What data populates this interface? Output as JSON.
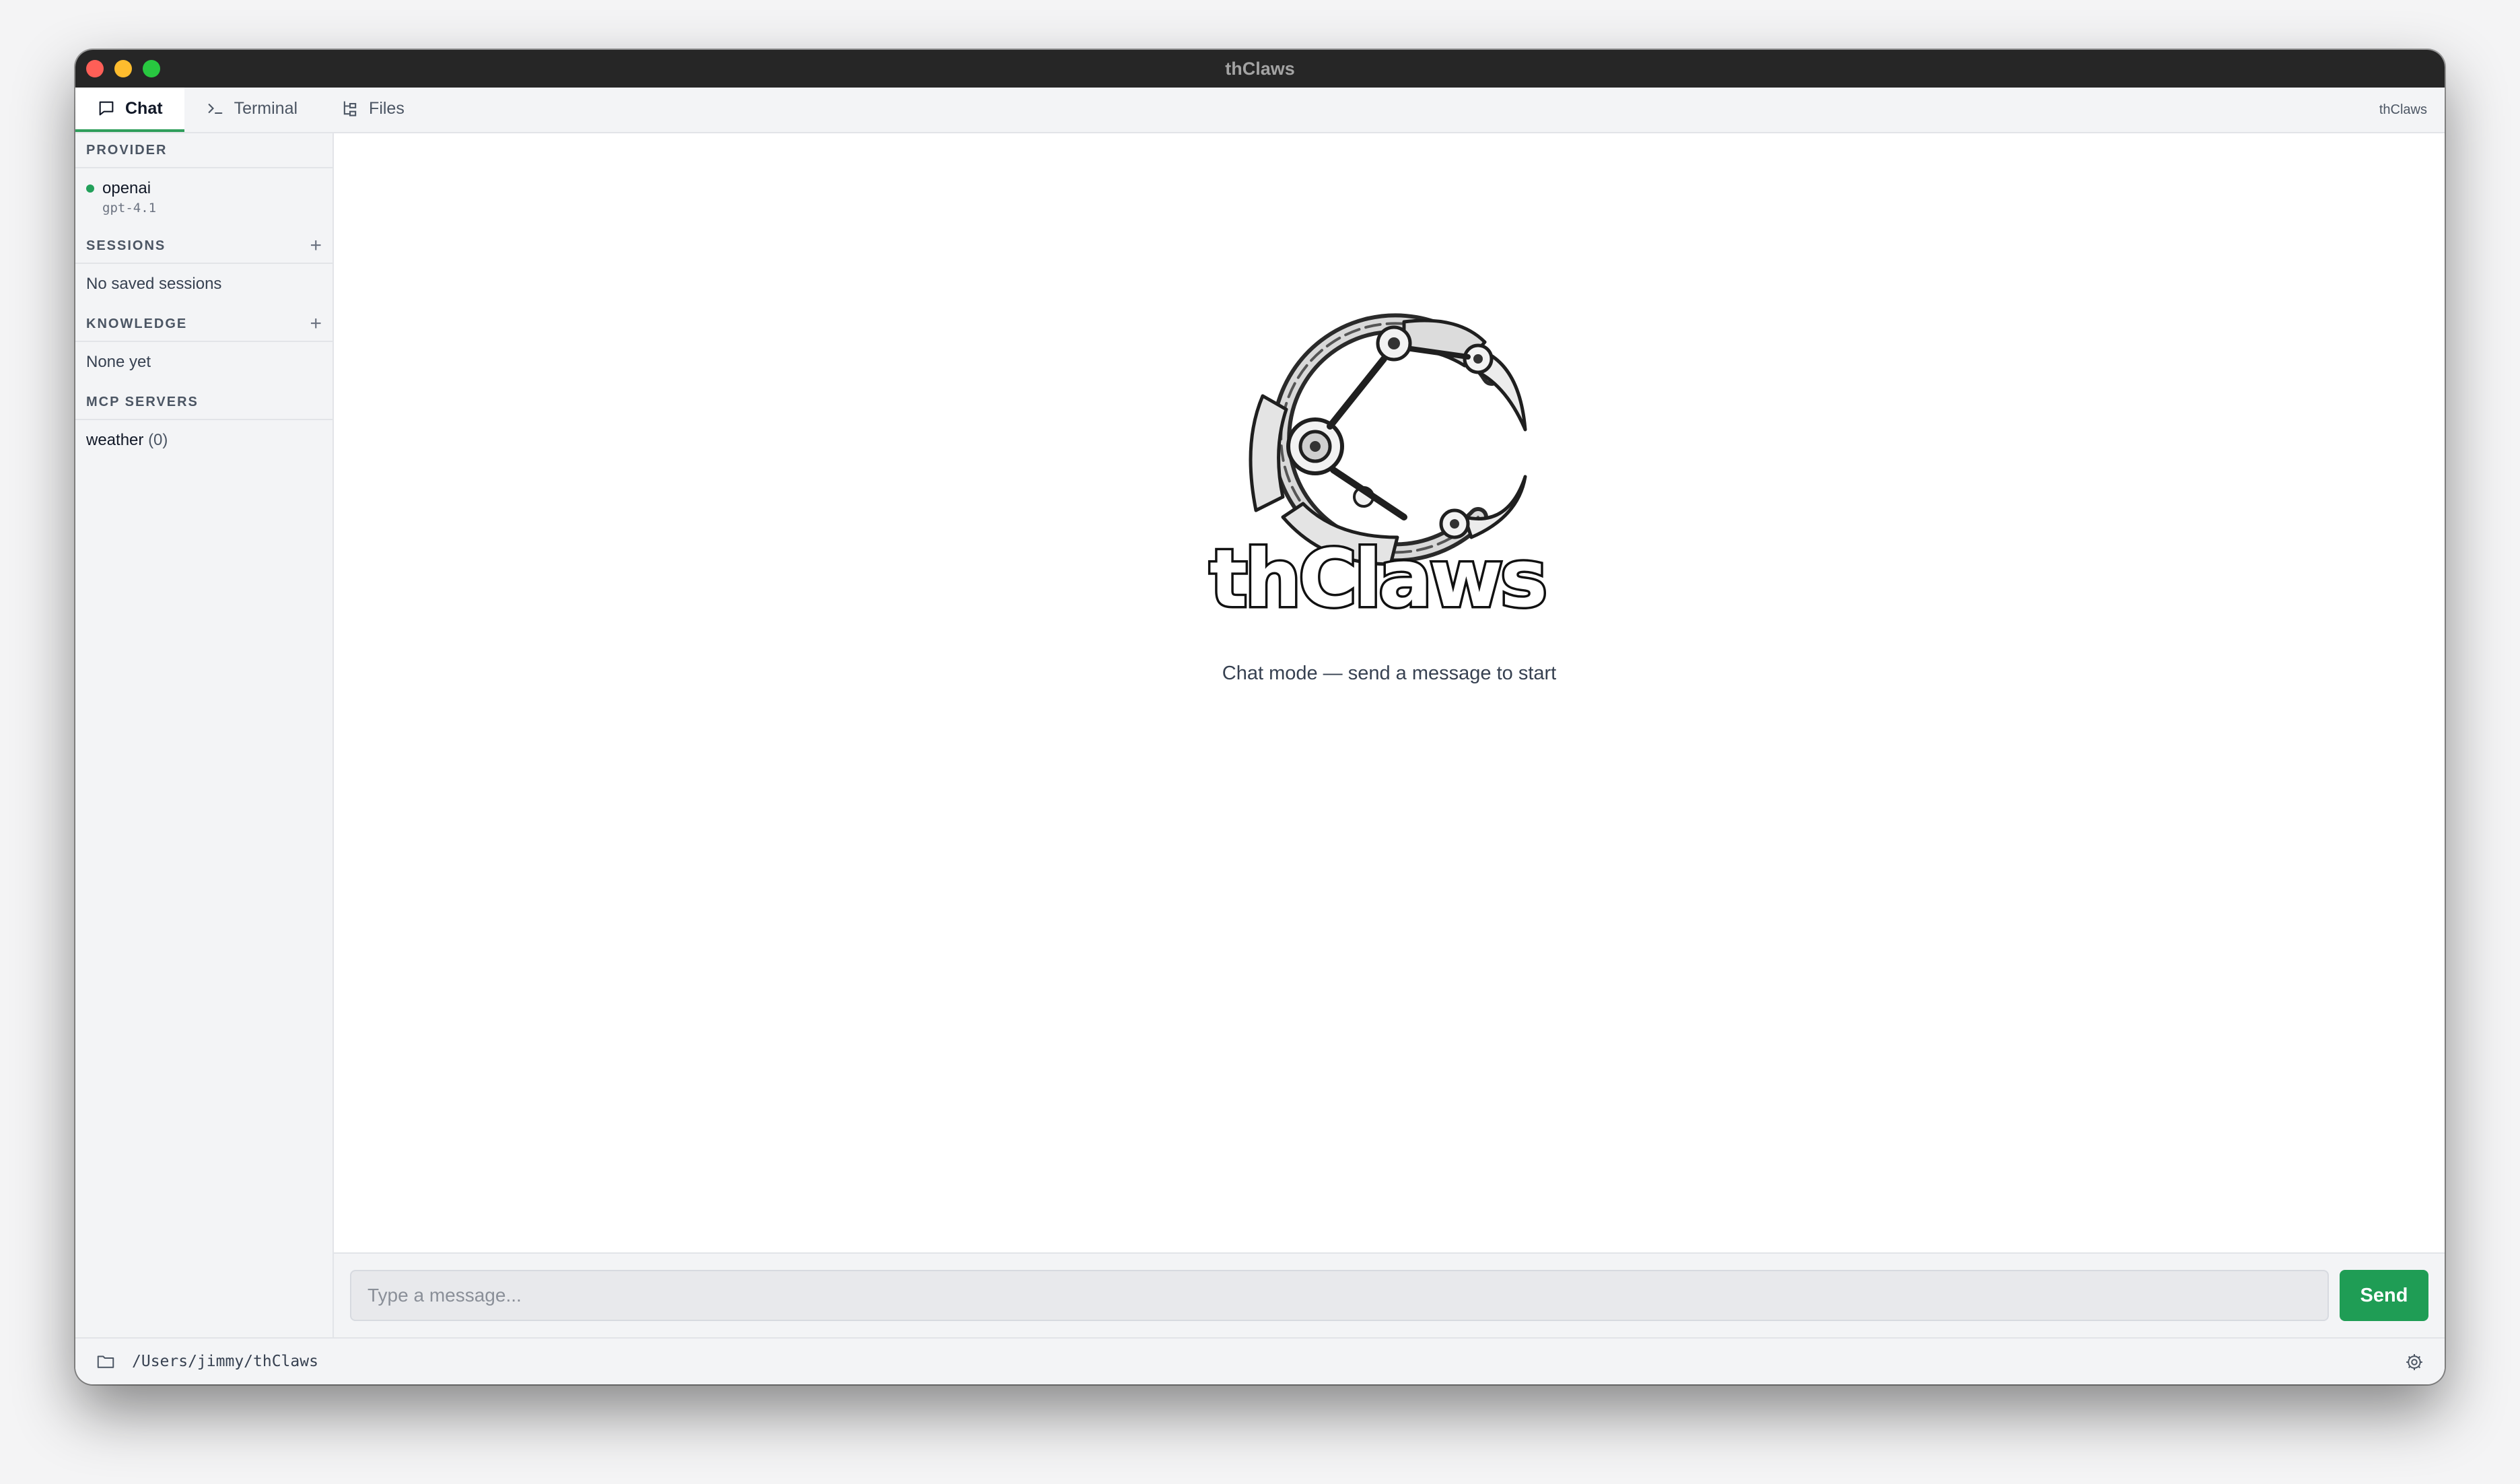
{
  "window": {
    "title": "thClaws"
  },
  "tabs": [
    {
      "label": "Chat",
      "icon": "chat-bubble-icon",
      "active": true
    },
    {
      "label": "Terminal",
      "icon": "terminal-prompt-icon",
      "active": false
    },
    {
      "label": "Files",
      "icon": "file-tree-icon",
      "active": false
    }
  ],
  "tabbar": {
    "app_name": "thClaws"
  },
  "sidebar": {
    "provider": {
      "header": "PROVIDER",
      "name": "openai",
      "model": "gpt-4.1",
      "status_color": "#22a05a"
    },
    "sessions": {
      "header": "SESSIONS",
      "add": "+",
      "empty": "No saved sessions"
    },
    "knowledge": {
      "header": "KNOWLEDGE",
      "add": "+",
      "empty": "None yet"
    },
    "mcp": {
      "header": "MCP SERVERS",
      "items": [
        {
          "name": "weather",
          "count": "(0)"
        }
      ]
    }
  },
  "chat": {
    "logo_text": "thClaws",
    "empty_message": "Chat mode — send a message to start",
    "input_placeholder": "Type a message...",
    "send_label": "Send"
  },
  "status": {
    "path": "/Users/jimmy/thClaws"
  },
  "colors": {
    "accent": "#1f9d55",
    "titlebar": "#262626"
  }
}
